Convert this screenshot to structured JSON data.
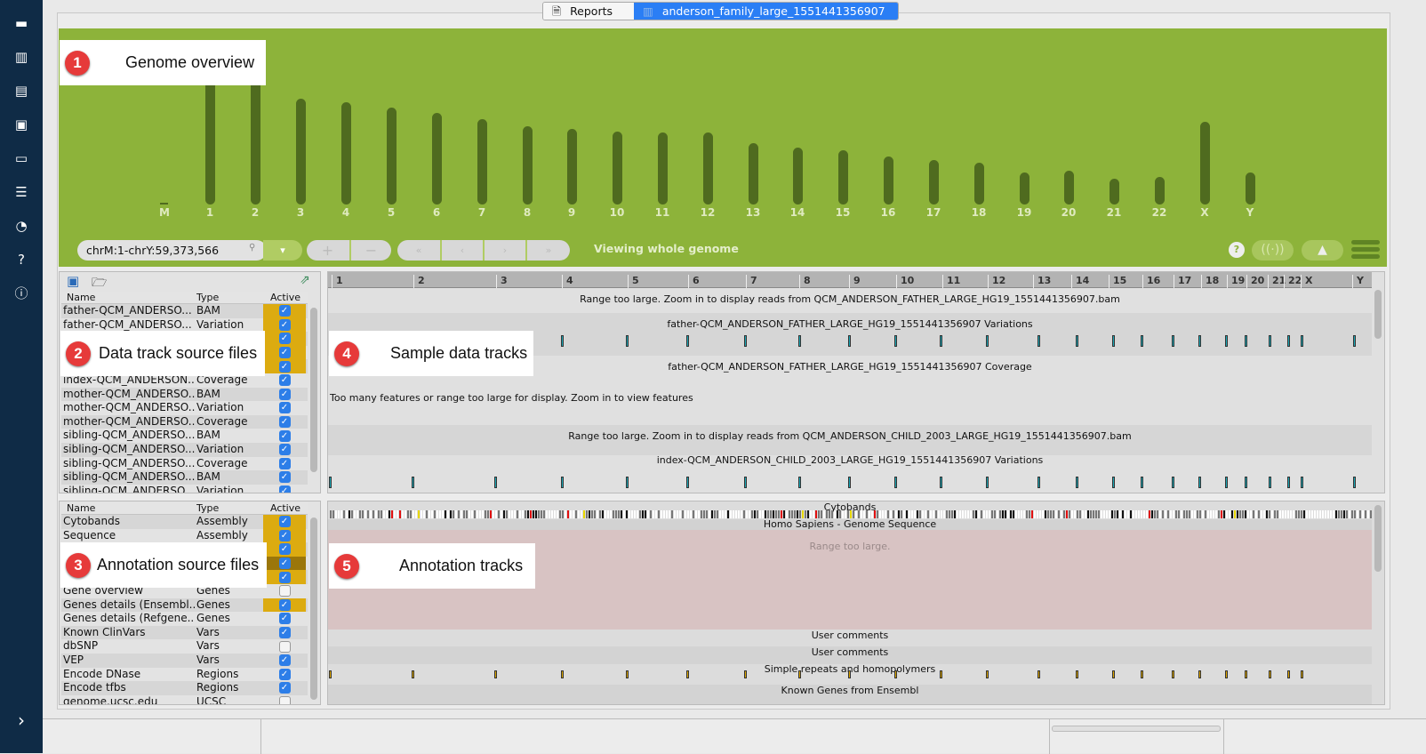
{
  "sidebar": {
    "icons": [
      "folder-icon",
      "chart-icon",
      "document-icon",
      "bam-icon",
      "terminal-icon",
      "list-icon",
      "history-icon",
      "help-icon",
      "info-icon"
    ],
    "expand": "›"
  },
  "tabs": [
    {
      "label": "Reports",
      "icon": "document-icon"
    },
    {
      "label": "anderson_family_large_1551441356907",
      "icon": "genome-icon",
      "active": true
    }
  ],
  "genome": {
    "chromosomes": [
      {
        "name": "M",
        "size_mb": 0.016
      },
      {
        "name": "1",
        "size_mb": 249
      },
      {
        "name": "2",
        "size_mb": 243
      },
      {
        "name": "3",
        "size_mb": 198
      },
      {
        "name": "4",
        "size_mb": 191
      },
      {
        "name": "5",
        "size_mb": 181
      },
      {
        "name": "6",
        "size_mb": 171
      },
      {
        "name": "7",
        "size_mb": 159
      },
      {
        "name": "8",
        "size_mb": 146
      },
      {
        "name": "9",
        "size_mb": 141
      },
      {
        "name": "10",
        "size_mb": 136
      },
      {
        "name": "11",
        "size_mb": 135
      },
      {
        "name": "12",
        "size_mb": 134
      },
      {
        "name": "13",
        "size_mb": 115
      },
      {
        "name": "14",
        "size_mb": 107
      },
      {
        "name": "15",
        "size_mb": 102
      },
      {
        "name": "16",
        "size_mb": 90
      },
      {
        "name": "17",
        "size_mb": 83
      },
      {
        "name": "18",
        "size_mb": 78
      },
      {
        "name": "19",
        "size_mb": 59
      },
      {
        "name": "20",
        "size_mb": 63
      },
      {
        "name": "21",
        "size_mb": 48
      },
      {
        "name": "22",
        "size_mb": 51
      },
      {
        "name": "X",
        "size_mb": 155
      },
      {
        "name": "Y",
        "size_mb": 59
      }
    ],
    "location": "chrM:1-chrY:59,373,566",
    "status": "Viewing whole genome",
    "zoom_in": "+",
    "zoom_out": "−",
    "first": "«",
    "prev": "‹",
    "next": "›",
    "last": "»",
    "help": "?",
    "color": "#8db33a"
  },
  "callouts": [
    {
      "num": "1",
      "label": "Genome overview"
    },
    {
      "num": "2",
      "label": "Data track source files"
    },
    {
      "num": "3",
      "label": "Annotation source files"
    },
    {
      "num": "4",
      "label": "Sample data tracks"
    },
    {
      "num": "5",
      "label": "Annotation tracks"
    }
  ],
  "data_sources": {
    "headers": [
      "Name",
      "Type",
      "Active"
    ],
    "rows": [
      {
        "name": "father-QCM_ANDERSO...",
        "type": "BAM",
        "active": true,
        "hl": true
      },
      {
        "name": "father-QCM_ANDERSO...",
        "type": "Variation",
        "active": true,
        "hl": true
      },
      {
        "name": "",
        "type": "",
        "active": true,
        "hl": true
      },
      {
        "name": "",
        "type": "",
        "active": true,
        "hl": true
      },
      {
        "name": "",
        "type": "",
        "active": true,
        "hl": true
      },
      {
        "name": "index-QCM_ANDERSON...",
        "type": "Coverage",
        "active": true
      },
      {
        "name": "mother-QCM_ANDERSO...",
        "type": "BAM",
        "active": true
      },
      {
        "name": "mother-QCM_ANDERSO...",
        "type": "Variation",
        "active": true
      },
      {
        "name": "mother-QCM_ANDERSO...",
        "type": "Coverage",
        "active": true
      },
      {
        "name": "sibling-QCM_ANDERSO...",
        "type": "BAM",
        "active": true
      },
      {
        "name": "sibling-QCM_ANDERSO...",
        "type": "Variation",
        "active": true
      },
      {
        "name": "sibling-QCM_ANDERSO...",
        "type": "Coverage",
        "active": true
      },
      {
        "name": "sibling-QCM_ANDERSO...",
        "type": "BAM",
        "active": true
      },
      {
        "name": "sibling-QCM_ANDERSO...",
        "type": "Variation",
        "active": true
      }
    ]
  },
  "annotation_sources": {
    "headers": [
      "Name",
      "Type",
      "Active"
    ],
    "rows": [
      {
        "name": "Cytobands",
        "type": "Assembly",
        "active": true,
        "hl": true
      },
      {
        "name": "Sequence",
        "type": "Assembly",
        "active": true,
        "hl": true
      },
      {
        "name": "",
        "type": "",
        "active": true,
        "hl": true
      },
      {
        "name": "",
        "type": "",
        "active": true,
        "hd": true
      },
      {
        "name": "",
        "type": "",
        "active": true,
        "hl": true
      },
      {
        "name": "Gene overview",
        "type": "Genes",
        "active": false
      },
      {
        "name": "Genes details (Ensembl...",
        "type": "Genes",
        "active": true,
        "hl": true
      },
      {
        "name": "Genes details (Refgene...",
        "type": "Genes",
        "active": true
      },
      {
        "name": "Known ClinVars",
        "type": "Vars",
        "active": true
      },
      {
        "name": "dbSNP",
        "type": "Vars",
        "active": false
      },
      {
        "name": "VEP",
        "type": "Vars",
        "active": true
      },
      {
        "name": "Encode DNase",
        "type": "Regions",
        "active": true
      },
      {
        "name": "Encode tfbs",
        "type": "Regions",
        "active": true
      },
      {
        "name": "genome.ucsc.edu",
        "type": "UCSC",
        "active": false
      }
    ]
  },
  "ruler": [
    "1",
    "2",
    "3",
    "4",
    "5",
    "6",
    "7",
    "8",
    "9",
    "10",
    "11",
    "12",
    "13",
    "14",
    "15",
    "16",
    "17",
    "18",
    "19",
    "20",
    "21",
    "22",
    "X",
    "Y"
  ],
  "sample_tracks": [
    "Range too large. Zoom in to display reads from QCM_ANDERSON_FATHER_LARGE_HG19_1551441356907.bam",
    "father-QCM_ANDERSON_FATHER_LARGE_HG19_1551441356907 Variations",
    "father-QCM_ANDERSON_FATHER_LARGE_HG19_1551441356907 Coverage",
    "Too many features or range too large for display.  Zoom in to view features",
    "Range too large. Zoom in to display reads from QCM_ANDERSON_CHILD_2003_LARGE_HG19_1551441356907.bam",
    "index-QCM_ANDERSON_CHILD_2003_LARGE_HG19_1551441356907 Variations"
  ],
  "annotation_tracks": {
    "cytobands": "Cytobands",
    "sequence": "Homo Sapiens - Genome Sequence",
    "sequence_msg": "Range too large.",
    "comments1": "User comments",
    "comments2": "User comments",
    "repeats": "Simple repeats and homopolymers",
    "ensembl": "Known Genes from Ensembl"
  },
  "colors": {
    "variation_marker": "#1aa9b8",
    "repeat_marker": "#e0a800",
    "highlight": "#dcab10",
    "sequence_bg": "#d8c3c3"
  }
}
